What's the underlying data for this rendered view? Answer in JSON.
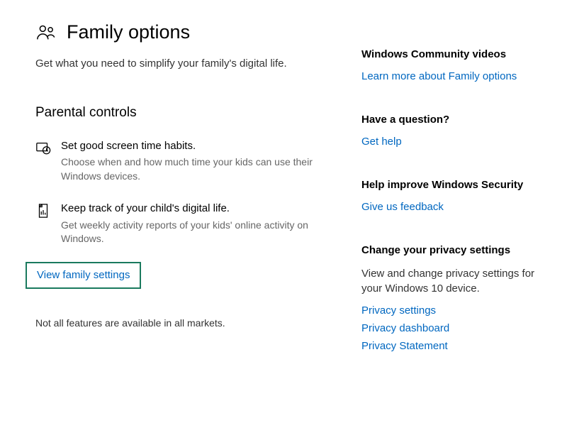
{
  "header": {
    "title": "Family options",
    "subtitle": "Get what you need to simplify your family's digital life."
  },
  "parental": {
    "heading": "Parental controls",
    "features": [
      {
        "title": "Set good screen time habits.",
        "desc": "Choose when and how much time your kids can use their Windows devices."
      },
      {
        "title": "Keep track of your child's digital life.",
        "desc": "Get weekly activity reports of your kids' online activity on Windows."
      }
    ],
    "view_link": "View family settings"
  },
  "note": "Not all features are available in all markets.",
  "sidebar": {
    "community": {
      "heading": "Windows Community videos",
      "link": "Learn more about Family options"
    },
    "question": {
      "heading": "Have a question?",
      "link": "Get help"
    },
    "feedback": {
      "heading": "Help improve Windows Security",
      "link": "Give us feedback"
    },
    "privacy": {
      "heading": "Change your privacy settings",
      "desc": "View and change privacy settings for your Windows 10 device.",
      "links": {
        "settings": "Privacy settings",
        "dashboard": "Privacy dashboard",
        "statement": "Privacy Statement"
      }
    }
  }
}
